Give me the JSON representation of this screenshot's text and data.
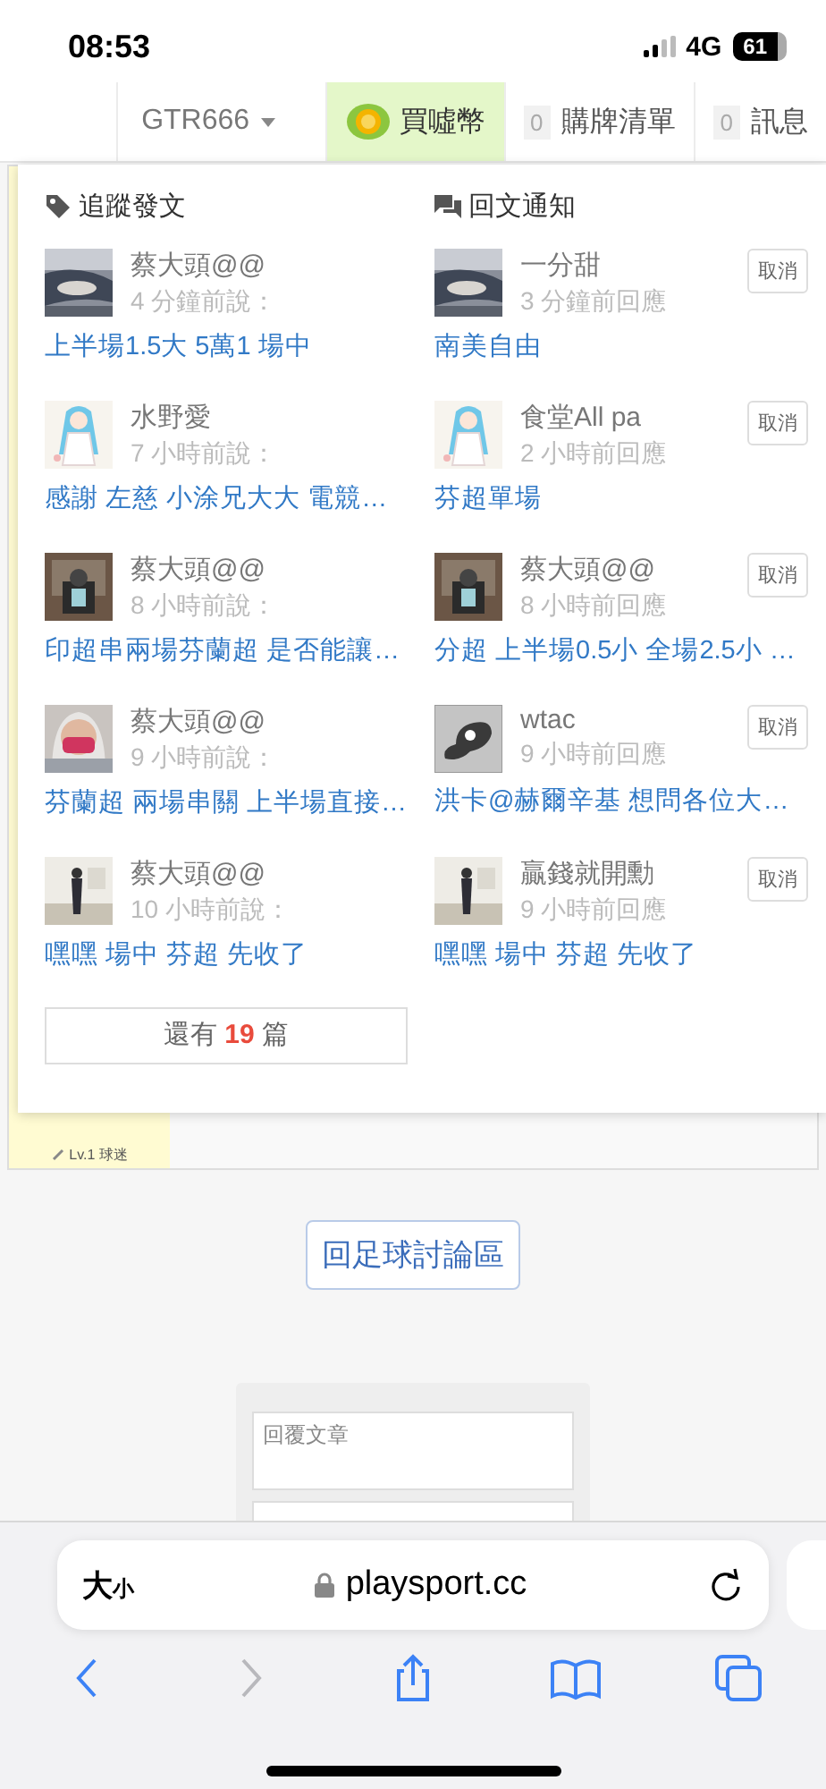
{
  "status_bar": {
    "time": "08:53",
    "network": "4G",
    "battery": "61"
  },
  "nav": {
    "user": "GTR666",
    "coins": "買噓幣",
    "items": [
      {
        "count": "0",
        "label": "購牌清單"
      },
      {
        "count": "0",
        "label": "訊息"
      }
    ]
  },
  "dropdown": {
    "followed": {
      "title": "追蹤發文",
      "posts": [
        {
          "author": "蔡大頭@@",
          "time": "4 分鐘前說：",
          "title": "上半場1.5大 5萬1 場中"
        },
        {
          "author": "水野愛",
          "time": "7 小時前說：",
          "title": "感謝 左慈 小涂兄大大 電競…"
        },
        {
          "author": "蔡大頭@@",
          "time": "8 小時前說：",
          "title": "印超串兩場芬蘭超 是否能讓…"
        },
        {
          "author": "蔡大頭@@",
          "time": "9 小時前說：",
          "title": "芬蘭超 兩場串關 上半場直接…"
        },
        {
          "author": "蔡大頭@@",
          "time": "10 小時前說：",
          "title": "嘿嘿 場中 芬超 先收了"
        }
      ]
    },
    "replies": {
      "title": "回文通知",
      "posts": [
        {
          "author": "一分甜",
          "time": "3 分鐘前回應",
          "title": "南美自由",
          "action": "取消"
        },
        {
          "author": "食堂All pa",
          "time": "2 小時前回應",
          "title": "芬超單場",
          "action": "取消"
        },
        {
          "author": "蔡大頭@@",
          "time": "8 小時前回應",
          "title": "分超 上半場0.5小 全場2.5小 …",
          "action": "取消"
        },
        {
          "author": "wtac",
          "time": "9 小時前回應",
          "title": "洪卡@赫爾辛基 想問各位大…",
          "avatar": {
            "kind": "placeholder"
          },
          "action": "取消"
        },
        {
          "author": "贏錢就開勳",
          "time": "9 小時前回應",
          "title": "嘿嘿 場中 芬超 先收了",
          "action": "取消"
        }
      ]
    },
    "more": "還有 **19** 篇"
  },
  "profile": {
    "level": "Lv.1 球迷"
  },
  "back_button": "回足球討論區",
  "reply_form": {
    "placeholder": "回覆文章"
  },
  "browser": {
    "text_size": "大小",
    "url": "playsport.cc",
    "nav_buttons": [
      {
        "kind": "back",
        "disabled": false
      },
      {
        "kind": "forward",
        "disabled": true
      },
      {
        "kind": "share",
        "disabled": false
      },
      {
        "kind": "bookmarks",
        "disabled": false
      },
      {
        "kind": "tabs",
        "disabled": false
      }
    ]
  }
}
